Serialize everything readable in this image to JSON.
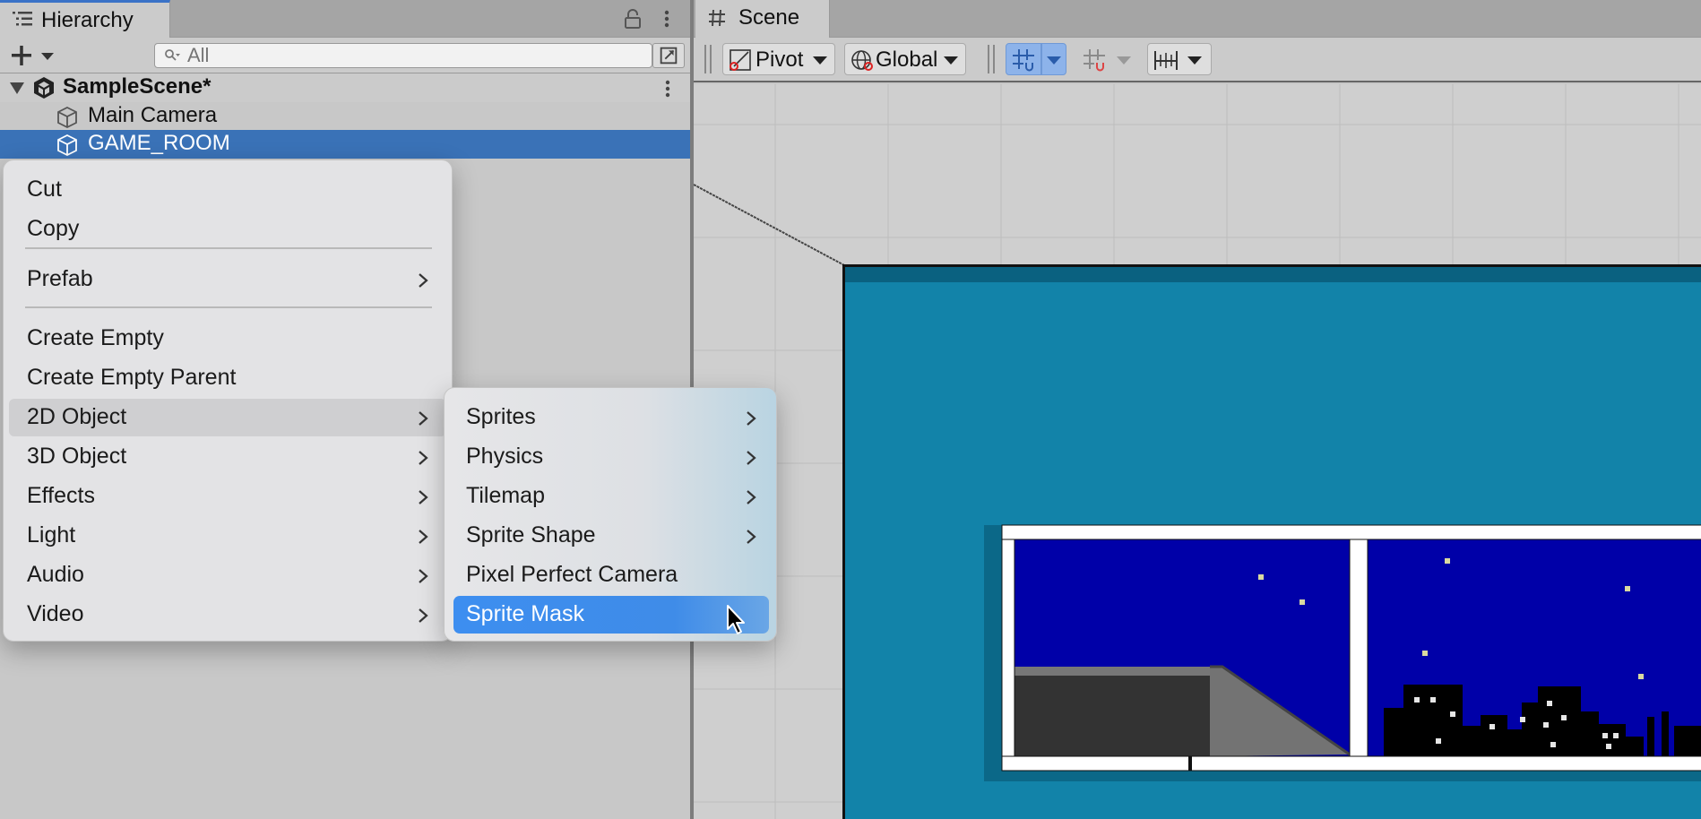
{
  "hierarchy": {
    "tab_label": "Hierarchy",
    "search_placeholder": "All",
    "scene_name": "SampleScene*",
    "items": [
      {
        "label": "Main Camera",
        "selected": false
      },
      {
        "label": "GAME_ROOM",
        "selected": true
      }
    ]
  },
  "scene_view": {
    "tab_label": "Scene",
    "toolbar": {
      "pivot_label": "Pivot",
      "global_label": "Global",
      "grid_snapping_active": true
    }
  },
  "context_menu": {
    "items": [
      {
        "label": "Cut",
        "has_submenu": false
      },
      {
        "label": "Copy",
        "has_submenu": false
      },
      {
        "label": "Prefab",
        "has_submenu": true
      },
      {
        "label": "Create Empty",
        "has_submenu": false
      },
      {
        "label": "Create Empty Parent",
        "has_submenu": false
      },
      {
        "label": "2D Object",
        "has_submenu": true,
        "active": true
      },
      {
        "label": "3D Object",
        "has_submenu": true
      },
      {
        "label": "Effects",
        "has_submenu": true
      },
      {
        "label": "Light",
        "has_submenu": true
      },
      {
        "label": "Audio",
        "has_submenu": true
      },
      {
        "label": "Video",
        "has_submenu": true
      }
    ]
  },
  "submenu_2d_object": {
    "items": [
      {
        "label": "Sprites",
        "has_submenu": true
      },
      {
        "label": "Physics",
        "has_submenu": true
      },
      {
        "label": "Tilemap",
        "has_submenu": true
      },
      {
        "label": "Sprite Shape",
        "has_submenu": true
      },
      {
        "label": "Pixel Perfect Camera",
        "has_submenu": false
      },
      {
        "label": "Sprite Mask",
        "has_submenu": false,
        "selected": true
      }
    ]
  },
  "colors": {
    "selection_blue": "#3a72b7",
    "menu_highlight": "#3d8ef0",
    "room_background": "#1283a9",
    "night_sky": "#0000a8"
  }
}
